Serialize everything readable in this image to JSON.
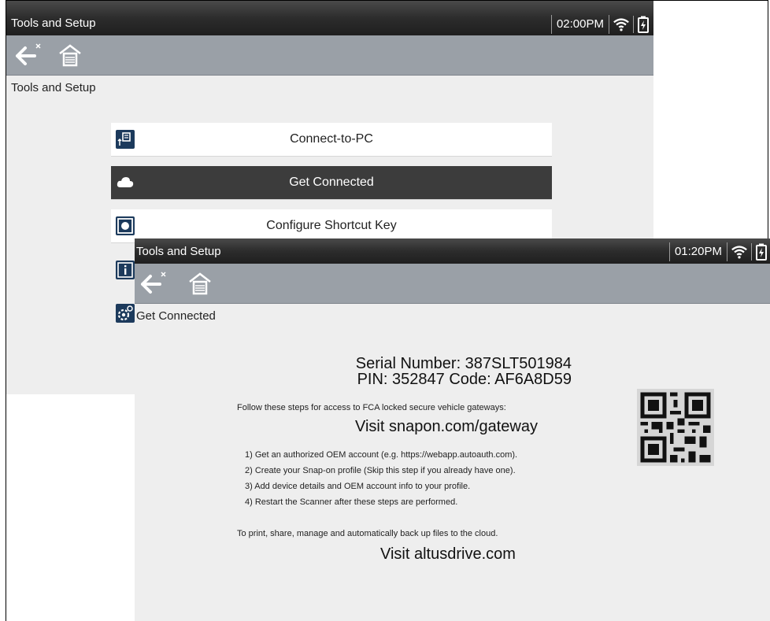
{
  "screen1": {
    "title": "Tools and Setup",
    "time": "02:00PM",
    "breadcrumb": "Tools and Setup",
    "menu": [
      {
        "label": "Connect-to-PC",
        "icon": "connect-pc-icon",
        "active": false
      },
      {
        "label": "Get Connected",
        "icon": "cloud-icon",
        "active": true
      },
      {
        "label": "Configure Shortcut Key",
        "icon": "shortcut-key-icon",
        "active": false
      }
    ],
    "hidden_items_icons": [
      "info-icon",
      "settings-gear-icon"
    ]
  },
  "screen2": {
    "title": "Tools and Setup",
    "time": "01:20PM",
    "breadcrumb": "Get Connected",
    "serial": "Serial Number: 387SLT501984",
    "pin": "PIN: 352847  Code: AF6A8D59",
    "steps_intro": "Follow these steps for access to FCA locked secure vehicle gateways:",
    "visit_gateway": "Visit snapon.com/gateway",
    "steps": [
      "1) Get an authorized OEM account (e.g. https://webapp.autoauth.com).",
      "2) Create your Snap-on profile (Skip this step if you already have one).",
      "3) Add device details and OEM account info to your profile.",
      "4) Restart the Scanner after these steps are performed."
    ],
    "cloud_text": "To print, share, manage and automatically back up files to the cloud.",
    "visit_altus": "Visit altusdrive.com"
  },
  "colors": {
    "statusbar": "#2c2c2c",
    "toolbar": "#9aa0a7",
    "icon_blue": "#1c3a5c",
    "active_row": "#3c3c3c",
    "background": "#eeeeee"
  }
}
